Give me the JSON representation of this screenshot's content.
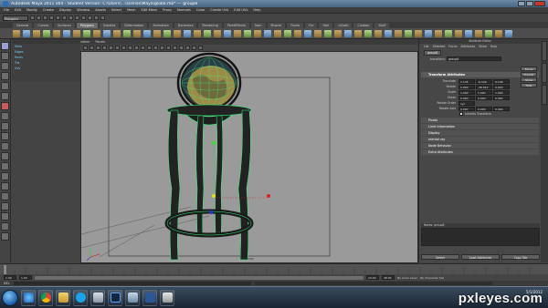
{
  "window": {
    "title": "Autodesk Maya 2011 x64 - Student Version: C:\\Users\\...\\scenes\\Maya\\globe.mb* --- group8"
  },
  "menus": [
    "File",
    "Edit",
    "Modify",
    "Create",
    "Display",
    "Window",
    "Assets",
    "Select",
    "Mesh",
    "Edit Mesh",
    "Proxy",
    "Normals",
    "Color",
    "Create UVs",
    "Edit UVs",
    "Help"
  ],
  "status": {
    "mode": "Polygons"
  },
  "shelf_tabs": [
    "General",
    "Curves",
    "Surfaces",
    "Polygons",
    "Subdivs",
    "Deformation",
    "Animation",
    "Dynamics",
    "Rendering",
    "PaintEffects",
    "Toon",
    "Muscle",
    "Fluids",
    "Fur",
    "Hair",
    "nCloth",
    "Custom",
    "Stuff"
  ],
  "shelf_active": 3,
  "viewport": {
    "menus": [
      "View",
      "Shading",
      "Lighting",
      "Show",
      "Renderer",
      "Panels"
    ],
    "camera_label": "persp"
  },
  "channelbox": {
    "columns": [
      "",
      "",
      ""
    ],
    "rows": [
      {
        "name": "Verts",
        "v1": "",
        "v2": ""
      },
      {
        "name": "Edges",
        "v1": "",
        "v2": ""
      },
      {
        "name": "Faces",
        "v1": "",
        "v2": ""
      },
      {
        "name": "Tris",
        "v1": "",
        "v2": ""
      },
      {
        "name": "UVs",
        "v1": "",
        "v2": ""
      }
    ]
  },
  "attr": {
    "header": "Attribute Editor",
    "menus": [
      "List",
      "Selected",
      "Focus",
      "Attributes",
      "Show",
      "Help"
    ],
    "tab": "group8",
    "transform_label": "transform:",
    "transform_value": "group8",
    "buttons": [
      "Focus",
      "Presets",
      "Show",
      "Hide"
    ],
    "section_open": "Transform Attributes",
    "rows": [
      {
        "label": "Translate",
        "x": "1.135",
        "y": "-6.109",
        "z": "0.199"
      },
      {
        "label": "Rotate",
        "x": "0.000",
        "y": "-46.912",
        "z": "0.000"
      },
      {
        "label": "Scale",
        "x": "1.000",
        "y": "1.000",
        "z": "1.000"
      },
      {
        "label": "Shear",
        "x": "0.000",
        "y": "0.000",
        "z": "0.000"
      },
      {
        "label": "Rotate Order",
        "x": "xyz",
        "y": "",
        "z": ""
      },
      {
        "label": "Rotate Axis",
        "x": "0.000",
        "y": "0.000",
        "z": "0.000"
      }
    ],
    "inherits": "Inherits Transform",
    "sections": [
      "Pivots",
      "Limit Information",
      "Display",
      "mental ray",
      "Node Behavior",
      "Extra Attributes"
    ],
    "notes_label": "Notes: group8",
    "bottom_buttons": [
      "Select",
      "Load Attributes",
      "Copy Tab"
    ]
  },
  "range": {
    "start": "1.00",
    "in": "1.00",
    "out": "24.00",
    "end": "48.00",
    "anim_layer": "No Anim Layer",
    "char_set": "No Character Set"
  },
  "cmdline": {
    "mel": "MEL"
  },
  "taskbar": {
    "time": "",
    "date": "5/1/2012",
    "apps": [
      "ie",
      "chrome",
      "explorer",
      "skype",
      "maya",
      "photoshop",
      "explorer2",
      "word",
      "other"
    ]
  },
  "watermark": "pxleyes.com"
}
